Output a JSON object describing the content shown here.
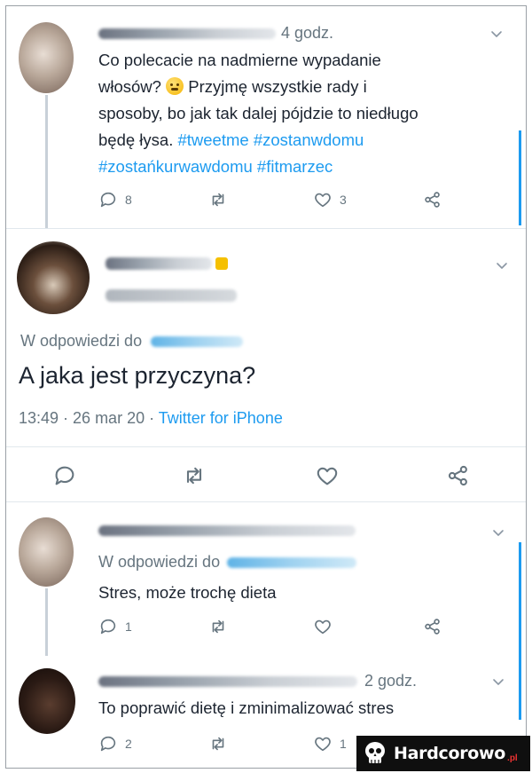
{
  "tweets": [
    {
      "time": "4 godz.",
      "text_line1": "Co polecacie na nadmierne wypadanie",
      "text_line2a": "włosów?",
      "text_line2b": "Przyjmę wszystkie rady i",
      "text_line3": "sposoby, bo jak tak dalej pójdzie to niedługo",
      "text_line4a": "będę łysa.",
      "hashtag1": "#tweetme",
      "hashtag2": "#zostanwdomu",
      "hashtag3": "#zostańkurwawdomu",
      "hashtag4": "#fitmarzec",
      "replies": "8",
      "retweets": "",
      "likes": "3"
    },
    {
      "reply_to_label": "W odpowiedzi do",
      "text": "A jaka jest przyczyna?",
      "timestamp": "13:49 · 26 mar 20 ·",
      "source": "Twitter for iPhone"
    },
    {
      "reply_to_label": "W odpowiedzi do",
      "text": "Stres, może trochę dieta",
      "replies": "1"
    },
    {
      "time": "2 godz.",
      "text": "To poprawić dietę i zminimalizować stres",
      "replies": "2",
      "likes": "1"
    }
  ],
  "watermark": {
    "text": "Hardcorowo",
    "suffix": ".pl"
  },
  "icons": [
    "reply-icon",
    "retweet-icon",
    "like-icon",
    "share-icon",
    "chevron-down-icon",
    "emoji-icon",
    "skull-icon"
  ]
}
